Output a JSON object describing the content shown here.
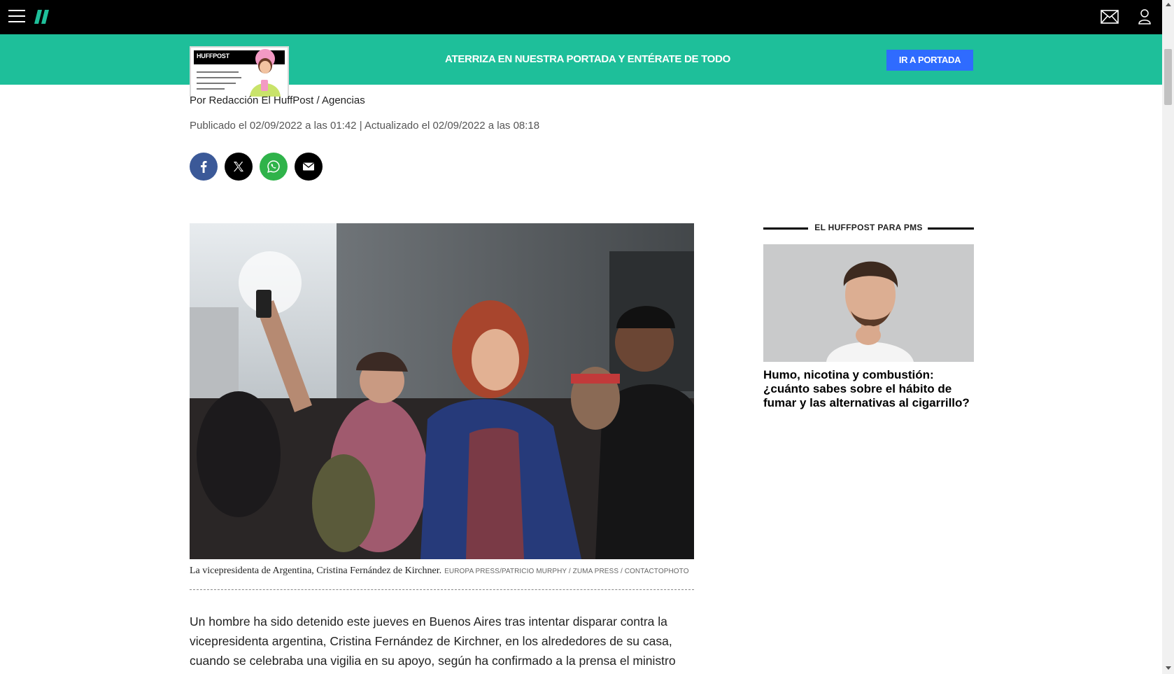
{
  "header": {
    "menu_icon": "hamburger-menu-icon",
    "logo_icon": "huffpost-logo-icon",
    "mail_icon": "mail-icon",
    "user_icon": "user-account-icon"
  },
  "banner": {
    "thumb_brand": "HUFFPOST",
    "text": "ATERRIZA EN NUESTRA PORTADA Y ENTÉRATE DE TODO",
    "button_label": "IR A PORTADA",
    "bg_color": "#1ebf9a",
    "button_color": "#2f6bff"
  },
  "article": {
    "byline": "Por Redacción El HuffPost / Agencias",
    "dates": "Publicado el 02/09/2022 a las 01:42 | Actualizado el 02/09/2022 a las 08:18",
    "share": [
      {
        "name": "facebook-share-button",
        "icon": "facebook-icon",
        "color": "#3b5998"
      },
      {
        "name": "x-share-button",
        "icon": "x-icon",
        "color": "#000000"
      },
      {
        "name": "whatsapp-share-button",
        "icon": "whatsapp-icon",
        "color": "#2fb34a"
      },
      {
        "name": "email-share-button",
        "icon": "email-icon",
        "color": "#000000"
      }
    ],
    "caption": "La vicepresidenta de Argentina, Cristina Fernández de Kirchner.",
    "credit": "EUROPA PRESS/PATRICIO MURPHY / ZUMA PRESS / CONTACTOPHOTO",
    "body_lines": [
      "Un hombre ha sido detenido este jueves en Buenos Aires tras intentar disparar contra la",
      "vicepresidenta argentina, Cristina Fernández de Kirchner, en los alrededores de su casa,",
      "cuando se celebraba una vigilia en su apoyo, según ha confirmado a la prensa el ministro"
    ]
  },
  "sidebar": {
    "heading": "EL HUFFPOST PARA PMS",
    "promo_title": "Humo, nicotina y combustión: ¿cuánto sabes sobre el hábito de fumar y las alternativas al cigarrillo?"
  }
}
